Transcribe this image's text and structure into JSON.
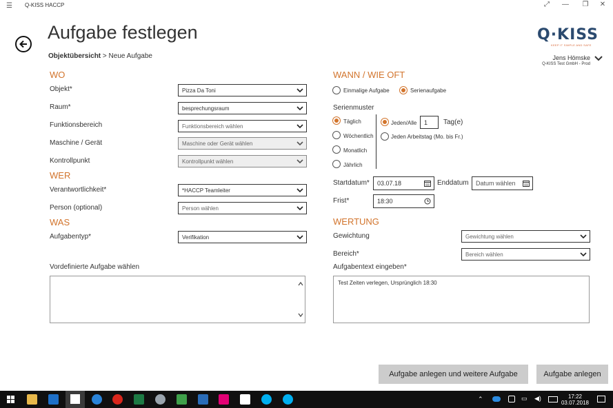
{
  "window": {
    "title": "Q-KISS HACCP"
  },
  "header": {
    "title": "Aufgabe festlegen",
    "breadcrumb_parent": "Objektübersicht",
    "breadcrumb_sep": ">",
    "breadcrumb_current": "Neue Aufgabe"
  },
  "logo": {
    "text": "Q·KISS",
    "tagline": "KEEP IT SIMPLE AND SAFE"
  },
  "user": {
    "name": "Jens  Hömske",
    "org": "Q-KISS Test GmbH - Prod"
  },
  "wo": {
    "heading": "WO",
    "objekt": {
      "label": "Objekt*",
      "value": "Pizza Da Toni"
    },
    "raum": {
      "label": "Raum*",
      "value": "besprechungsraum"
    },
    "funktionsbereich": {
      "label": "Funktionsbereich",
      "value": "Funktionsbereich wählen"
    },
    "maschine": {
      "label": "Maschine / Gerät",
      "value": "Maschine oder Gerät wählen"
    },
    "kontrollpunkt": {
      "label": "Kontrollpunkt",
      "value": "Kontrollpunkt wählen"
    }
  },
  "wer": {
    "heading": "WER",
    "verantwortlich": {
      "label": "Verantwortlichkeit*",
      "value": "*HACCP Teamleiter"
    },
    "person": {
      "label": "Person (optional)",
      "value": "Person wählen"
    }
  },
  "was": {
    "heading": "WAS",
    "aufgabentyp": {
      "label": "Aufgabentyp*",
      "value": "Verifikation"
    }
  },
  "vordefiniert": {
    "label": "Vordefinierte Aufgabe wählen"
  },
  "wann": {
    "heading": "WANN / WIE OFT",
    "einmalig": "Einmalige Aufgabe",
    "serie": "Serienaufgabe",
    "serienmuster_label": "Serienmuster",
    "muster": [
      "Täglich",
      "Wöchentlich",
      "Monatlich",
      "Jährlich"
    ],
    "selected_muster": "Täglich",
    "jeden_alle": "Jeden/Alle",
    "interval": "1",
    "tage_label": "Tag(e)",
    "arbeitstag": "Jeden Arbeitstag (Mo. bis Fr.)",
    "startdatum_label": "Startdatum*",
    "startdatum": "03.07.18",
    "enddatum_label": "Enddatum",
    "enddatum_placeholder": "Datum wählen",
    "frist_label": "Frist*",
    "frist": "18:30"
  },
  "wertung": {
    "heading": "WERTUNG",
    "gewichtung": {
      "label": "Gewichtung",
      "value": "Gewichtung wählen"
    },
    "bereich": {
      "label": "Bereich*",
      "value": "Bereich wählen"
    },
    "aufgabentext_label": "Aufgabentext eingeben*",
    "aufgabentext": "Test Zeiten verlegen, Ursprünglich 18:30"
  },
  "buttons": {
    "anlegen_weitere": "Aufgabe anlegen und weitere Aufgabe",
    "anlegen": "Aufgabe anlegen"
  },
  "taskbar": {
    "time": "17:22",
    "date": "03.07.2018"
  },
  "colors": {
    "accent": "#d2742c",
    "brand": "#2b4a6f"
  }
}
